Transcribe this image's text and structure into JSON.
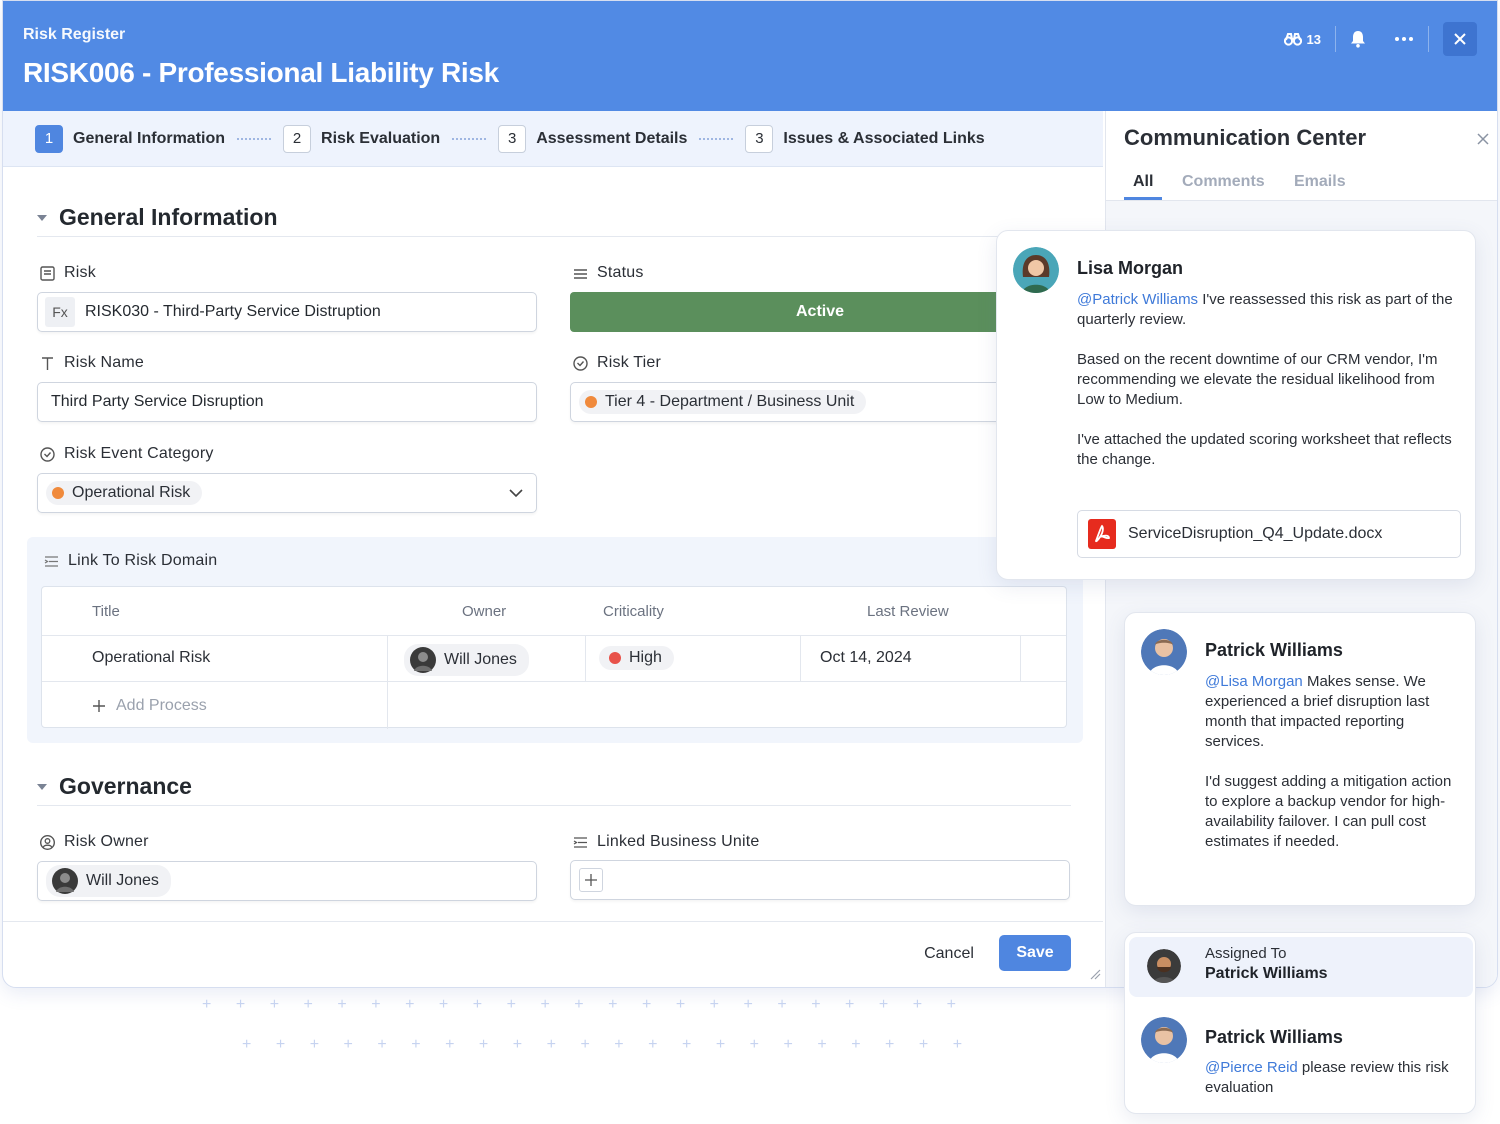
{
  "header": {
    "breadcrumb": "Risk Register",
    "title": "RISK006 - Professional Liability Risk",
    "watchers_count": "13"
  },
  "steps": [
    {
      "num": "1",
      "label": "General Information"
    },
    {
      "num": "2",
      "label": "Risk Evaluation"
    },
    {
      "num": "3",
      "label": "Assessment Details"
    },
    {
      "num": "3",
      "label": "Issues & Associated Links"
    }
  ],
  "general": {
    "section_title": "General Information",
    "risk_label": "Risk",
    "risk_fx": "Fx",
    "risk_value": "RISK030 - Third-Party Service Distruption",
    "status_label": "Status",
    "status_value": "Active",
    "risk_name_label": "Risk Name",
    "risk_name_value": "Third Party Service Disruption",
    "risk_tier_label": "Risk Tier",
    "risk_tier_value": "Tier 4 - Department / Business Unit",
    "event_category_label": "Risk Event Category",
    "event_category_value": "Operational Risk"
  },
  "domain": {
    "label": "Link To Risk Domain",
    "columns": [
      "Title",
      "Owner",
      "Criticality",
      "Last Review"
    ],
    "row": {
      "title": "Operational Risk",
      "owner": "Will Jones",
      "criticality": "High",
      "last_review": "Oct 14, 2024"
    },
    "add_process": "Add Process"
  },
  "governance": {
    "section_title": "Governance",
    "owner_label": "Risk Owner",
    "owner_value": "Will Jones",
    "linked_label": "Linked Business Unite"
  },
  "footer": {
    "cancel": "Cancel",
    "save": "Save"
  },
  "comm": {
    "title": "Communication Center",
    "tabs": [
      "All",
      "Comments",
      "Emails"
    ],
    "comment1": {
      "name": "Lisa Morgan",
      "mention": "@Patrick Williams",
      "p1": " I've reassessed this risk as part of the quarterly review.",
      "p2": "Based on the recent downtime of our CRM vendor, I'm recommending we elevate the residual likelihood from Low to Medium.",
      "p3": "I've attached the updated scoring worksheet that reflects the change.",
      "attachment": "ServiceDisruption_Q4_Update.docx"
    },
    "comment2": {
      "name": "Patrick Williams",
      "mention": "@Lisa Morgan",
      "p1": " Makes sense. We experienced a brief disruption last month that impacted reporting services.",
      "p2": "I'd suggest adding a mitigation action to explore a backup vendor for high-availability failover. I can pull cost estimates if needed."
    },
    "assigned": {
      "label": "Assigned To",
      "name": "Patrick Williams"
    },
    "comment3": {
      "name": "Patrick Williams",
      "mention": "@Pierce Reid",
      "p1": " please review this risk evaluation"
    }
  },
  "colors": {
    "header": "#518ae4",
    "status_active": "#5b8f5c",
    "dot_orange": "#f08a3c",
    "dot_red": "#e8524a",
    "link": "#3f7ad9"
  }
}
